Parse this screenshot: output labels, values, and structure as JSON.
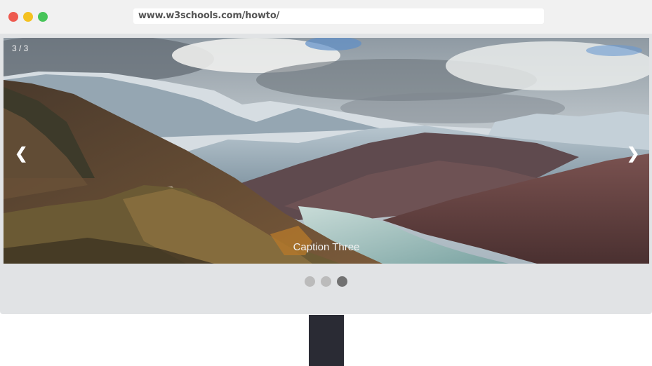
{
  "browser": {
    "url": "www.w3schools.com/howto/",
    "traffic_lights": [
      "close",
      "minimize",
      "maximize"
    ]
  },
  "slideshow": {
    "counter": "3 / 3",
    "caption": "Caption Three",
    "prev_label": "❮",
    "next_label": "❯",
    "indicators": [
      {
        "active": false
      },
      {
        "active": false
      },
      {
        "active": true
      }
    ]
  },
  "colors": {
    "frame": "#e1e3e5",
    "titlebar": "#f1f1f1",
    "indicator": "#bbbbbb",
    "indicator_active": "#717171",
    "stand": "#2a2b34"
  }
}
